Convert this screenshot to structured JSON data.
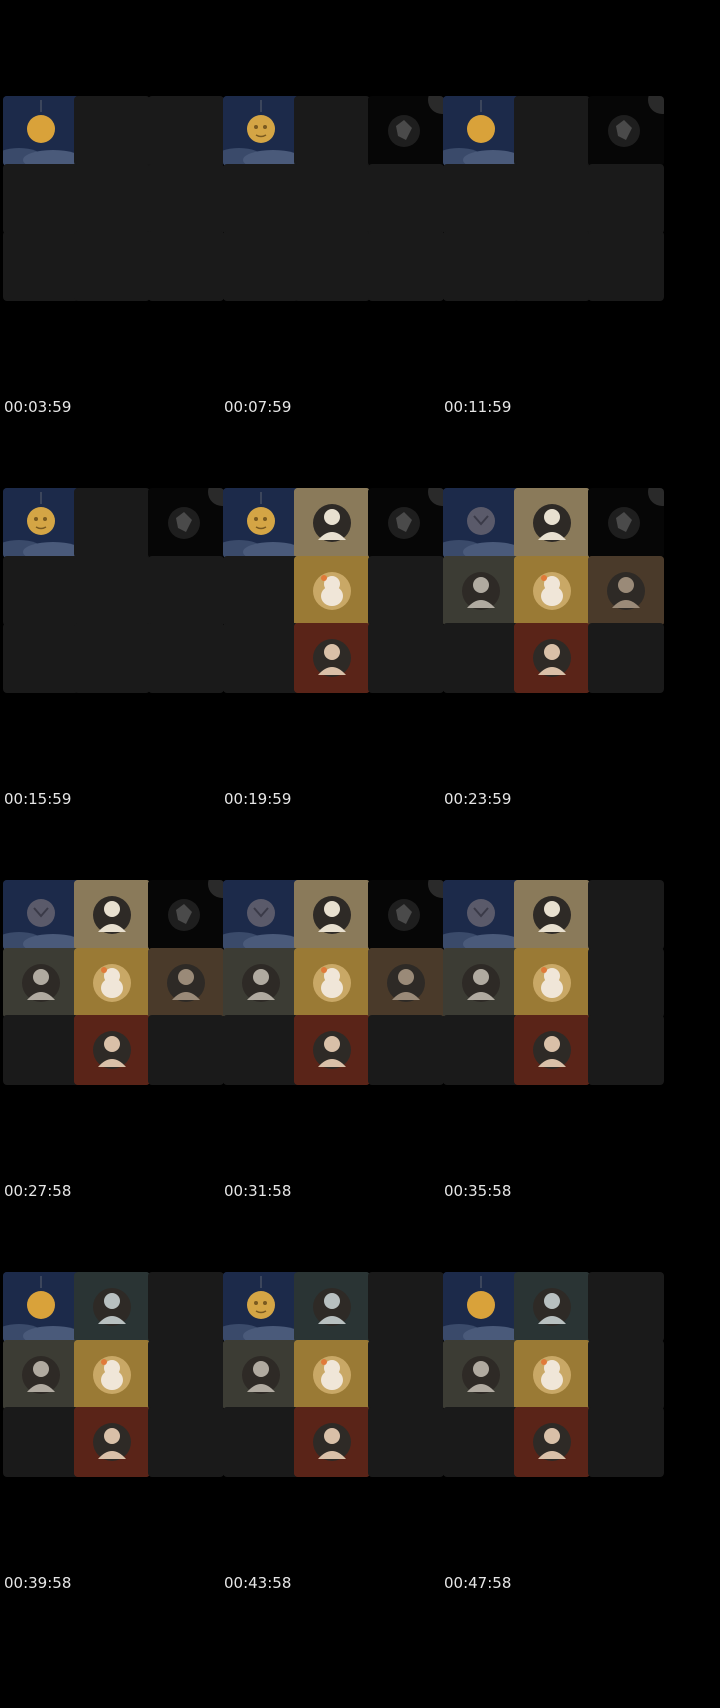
{
  "frames": [
    {
      "timestamp": "00:03:59",
      "tiles": [
        "moon",
        "empty",
        "empty",
        "empty",
        "empty",
        "empty",
        "empty",
        "empty",
        "empty"
      ]
    },
    {
      "timestamp": "00:07:59",
      "tiles": [
        "moon-face",
        "empty",
        "dark-circle",
        "empty",
        "empty",
        "empty",
        "empty",
        "empty",
        "empty"
      ]
    },
    {
      "timestamp": "00:11:59",
      "tiles": [
        "moon",
        "empty",
        "dark-circle",
        "empty",
        "empty",
        "empty",
        "empty",
        "empty",
        "empty"
      ]
    },
    {
      "timestamp": "00:15:59",
      "tiles": [
        "moon-face",
        "empty",
        "dark-circle",
        "empty",
        "empty",
        "empty",
        "empty",
        "empty",
        "empty"
      ]
    },
    {
      "timestamp": "00:19:59",
      "tiles": [
        "moon-face",
        "person-light",
        "dark-circle",
        "empty",
        "cat-toy",
        "empty",
        "empty",
        "person-red",
        "empty"
      ]
    },
    {
      "timestamp": "00:23:59",
      "tiles": [
        "owl",
        "person-light",
        "dark-circle",
        "person-gray",
        "cat-toy",
        "person-brown",
        "empty",
        "person-red",
        "empty"
      ]
    },
    {
      "timestamp": "00:27:58",
      "tiles": [
        "owl",
        "person-light",
        "dark-circle",
        "person-gray",
        "cat-toy",
        "person-brown",
        "empty",
        "person-red",
        "empty"
      ]
    },
    {
      "timestamp": "00:31:58",
      "tiles": [
        "owl",
        "person-light",
        "dark-circle",
        "person-gray",
        "cat-toy",
        "person-brown",
        "empty",
        "person-red",
        "empty"
      ]
    },
    {
      "timestamp": "00:35:58",
      "tiles": [
        "owl",
        "person-light",
        "empty",
        "person-gray",
        "cat-toy",
        "empty",
        "empty",
        "person-red",
        "empty"
      ]
    },
    {
      "timestamp": "00:39:58",
      "tiles": [
        "moon",
        "person-teal",
        "empty",
        "person-gray",
        "cat-toy",
        "empty",
        "empty",
        "person-red",
        "empty"
      ]
    },
    {
      "timestamp": "00:43:58",
      "tiles": [
        "moon-face",
        "person-teal",
        "empty",
        "person-gray",
        "cat-toy",
        "empty",
        "empty",
        "person-red",
        "empty"
      ]
    },
    {
      "timestamp": "00:47:58",
      "tiles": [
        "moon",
        "person-teal",
        "empty",
        "person-gray",
        "cat-toy",
        "empty",
        "empty",
        "person-red",
        "empty"
      ]
    }
  ],
  "tile_styles": {
    "moon": {
      "icon": "moon-icon",
      "bg": "#1c2a4a",
      "fg": "#d9a23a"
    },
    "moon-face": {
      "icon": "moon-face-icon",
      "bg": "#1c2a4a",
      "fg": "#d4a545"
    },
    "owl": {
      "icon": "owl-icon",
      "bg": "#1c2a4a",
      "fg": "#5a5a6a"
    },
    "dark-circle": {
      "icon": "dark-avatar-icon",
      "bg": "#060606",
      "fg": "#4a4a4a"
    },
    "person-light": {
      "icon": "person-avatar-icon",
      "bg": "#8a7a5a",
      "fg": "#e8e0d0"
    },
    "cat-toy": {
      "icon": "cat-avatar-icon",
      "bg": "#9a7a35",
      "fg": "#f0e6d8"
    },
    "person-red": {
      "icon": "person-avatar-icon",
      "bg": "#5a2418",
      "fg": "#d9c0a8"
    },
    "person-gray": {
      "icon": "person-avatar-icon",
      "bg": "#3c3c34",
      "fg": "#b0aaa0"
    },
    "person-brown": {
      "icon": "person-avatar-icon",
      "bg": "#4a3a2a",
      "fg": "#9a8a78"
    },
    "person-teal": {
      "icon": "person-avatar-icon",
      "bg": "#2a3434",
      "fg": "#b8c0c0"
    },
    "empty": {
      "icon": "",
      "bg": "#1a1a1a",
      "fg": ""
    }
  }
}
